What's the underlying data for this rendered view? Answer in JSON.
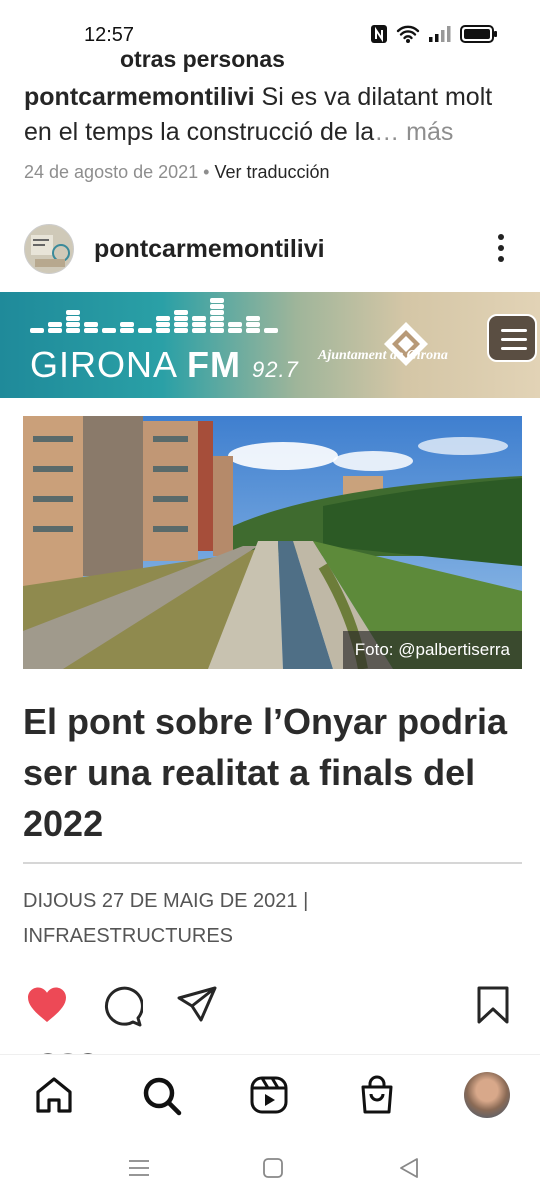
{
  "status_bar": {
    "time": "12:57",
    "icons": [
      "nfc-icon",
      "wifi-icon",
      "signal-icon",
      "battery-icon"
    ]
  },
  "caption": {
    "cut_title": "otras personas",
    "username": "pontcarmemontilivi",
    "text": " Si es va dilatant molt en el temps la construcció de la",
    "more": "… más",
    "date": "24 de agosto de 2021",
    "separator": " • ",
    "translate": "Ver traducción"
  },
  "post": {
    "username": "pontcarmemontilivi",
    "more_icon": "more-vertical-icon"
  },
  "media": {
    "brand_name": "GIRONA",
    "brand_fm": "FM",
    "brand_freq": "92.7",
    "ajuntament": "Ajuntament de Girona",
    "photo_credit": "Foto: @palbertiserra",
    "headline": "El pont sobre l’Onyar podria ser una realitat a finals del 2022",
    "article_date": "DIJOUS 27 DE MAIG DE 2021",
    "article_sep": " |",
    "article_category": "INFRAESTRUCTURES"
  },
  "actions": {
    "like_color": "#ed4956",
    "icons": [
      "heart-icon",
      "comment-icon",
      "share-icon",
      "bookmark-icon"
    ]
  },
  "bottom_nav": {
    "icons": [
      "home-icon",
      "search-icon",
      "reels-icon",
      "shop-icon",
      "profile-avatar"
    ]
  },
  "system_nav": {
    "icons": [
      "recent-apps-icon",
      "home-square-icon",
      "back-icon"
    ]
  }
}
